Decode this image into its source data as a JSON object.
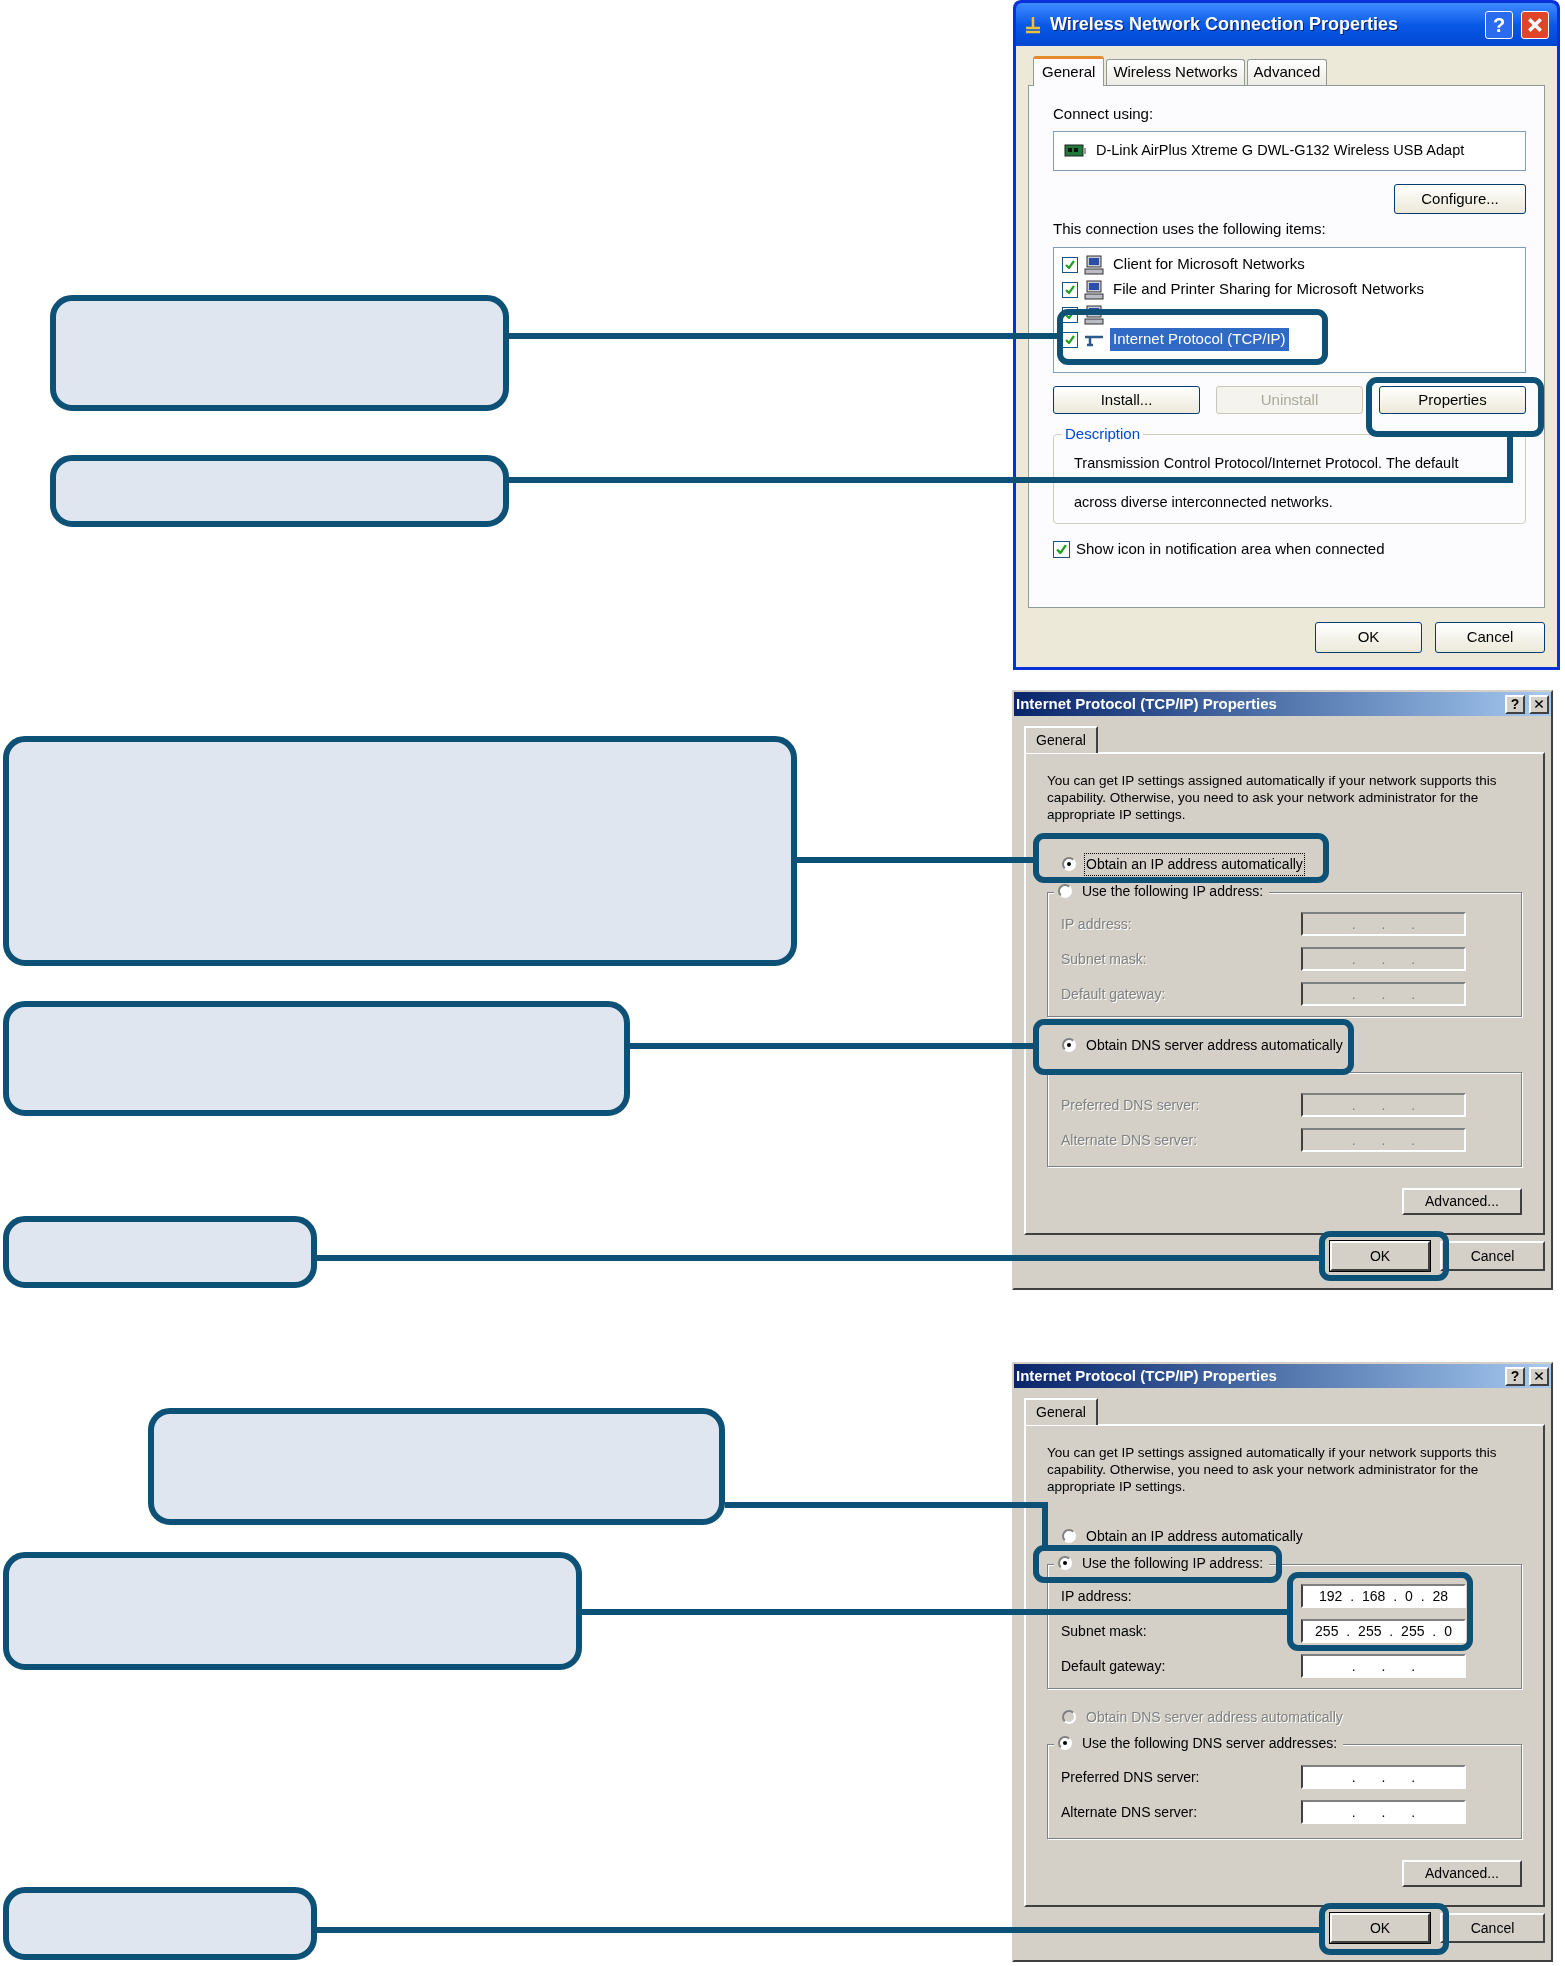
{
  "connection_dialog": {
    "title": "Wireless Network Connection Properties",
    "help_button": "?",
    "tabs": [
      {
        "label": "General",
        "selected": true
      },
      {
        "label": "Wireless Networks",
        "selected": false
      },
      {
        "label": "Advanced",
        "selected": false
      }
    ],
    "connect_using_label": "Connect using:",
    "adapter": "D-Link AirPlus Xtreme G DWL-G132 Wireless USB Adapt",
    "configure_button": "Configure...",
    "items_label": "This connection uses the following items:",
    "items": [
      {
        "label": "Client for Microsoft Networks",
        "checked": true,
        "selected": false,
        "kind": "client"
      },
      {
        "label": "File and Printer Sharing for Microsoft Networks",
        "checked": true,
        "selected": false,
        "kind": "service"
      },
      {
        "checked": true,
        "kind": "service"
      },
      {
        "label": "Internet Protocol (TCP/IP)",
        "checked": true,
        "selected": true,
        "kind": "protocol"
      }
    ],
    "buttons": [
      {
        "label": "Install...",
        "disabled": false
      },
      {
        "label": "Uninstall",
        "disabled": true
      },
      {
        "label": "Properties",
        "disabled": false
      }
    ],
    "description": {
      "title": "Description",
      "lines": [
        "Transmission Control Protocol/Internet Protocol. The default",
        "across diverse interconnected networks."
      ]
    },
    "show_icon": {
      "label": "Show icon in notification area when connected",
      "checked": true
    },
    "ok_button": "OK",
    "cancel_button": "Cancel"
  },
  "tcpip_dialogs": [
    {
      "title": "Internet Protocol (TCP/IP) Properties",
      "help_button": "?",
      "tab": "General",
      "intro": "You can get IP settings assigned automatically if your network supports this capability. Otherwise, you need to ask your network administrator for the appropriate IP settings.",
      "ip_mode": [
        {
          "label": "Obtain an IP address automatically",
          "selected": true,
          "disabled": false,
          "focused": true
        },
        {
          "label": "Use the following IP address:",
          "selected": false,
          "disabled": false,
          "focused": false
        }
      ],
      "ip_fields": [
        {
          "label": "IP address:",
          "value": ". . .",
          "disabled": true
        },
        {
          "label": "Subnet mask:",
          "value": ". . .",
          "disabled": true
        },
        {
          "label": "Default gateway:",
          "value": ". . .",
          "disabled": true
        }
      ],
      "dns_mode": [
        {
          "label": "Obtain DNS server address automatically",
          "selected": true,
          "disabled": false,
          "focused": false
        }
      ],
      "dns_fields": [
        {
          "label": "Preferred DNS server:",
          "value": ". . .",
          "disabled": true
        },
        {
          "label": "Alternate DNS server:",
          "value": ". . .",
          "disabled": true
        }
      ],
      "advanced_button": "Advanced...",
      "ok_button": "OK",
      "cancel_button": "Cancel"
    },
    {
      "title": "Internet Protocol (TCP/IP) Properties",
      "help_button": "?",
      "tab": "General",
      "intro": "You can get IP settings assigned automatically if your network supports this capability. Otherwise, you need to ask your network administrator for the appropriate IP settings.",
      "ip_mode": [
        {
          "label": "Obtain an IP address automatically",
          "selected": false,
          "disabled": false,
          "focused": false
        },
        {
          "label": "Use the following IP address:",
          "selected": true,
          "disabled": false,
          "focused": false
        }
      ],
      "ip_fields": [
        {
          "label": "IP address:",
          "value": "192 . 168 . 0 . 28",
          "disabled": false
        },
        {
          "label": "Subnet mask:",
          "value": "255 . 255 . 255 . 0",
          "disabled": false
        },
        {
          "label": "Default gateway:",
          "value": ". . .",
          "disabled": false
        }
      ],
      "dns_mode": [
        {
          "label": "Obtain DNS server address automatically",
          "selected": false,
          "disabled": true,
          "focused": false
        },
        {
          "label": "Use the following DNS server addresses:",
          "selected": true,
          "disabled": false,
          "focused": false
        }
      ],
      "dns_fields": [
        {
          "label": "Preferred DNS server:",
          "value": ". . .",
          "disabled": false
        },
        {
          "label": "Alternate DNS server:",
          "value": ". . .",
          "disabled": false
        }
      ],
      "advanced_button": "Advanced...",
      "ok_button": "OK",
      "cancel_button": "Cancel"
    }
  ]
}
